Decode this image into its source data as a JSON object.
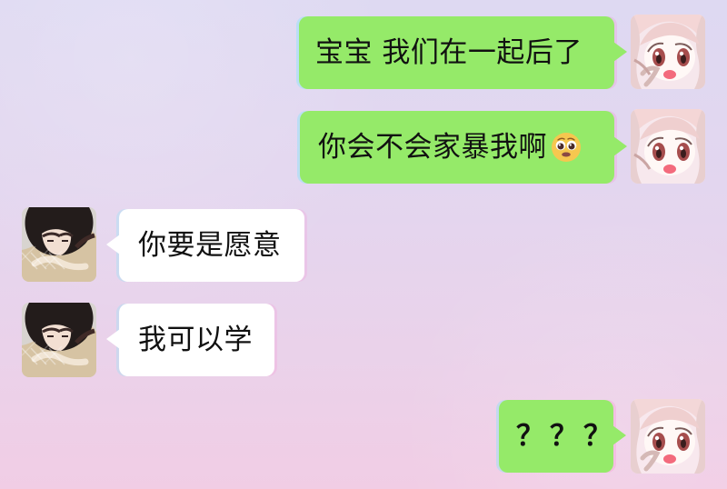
{
  "messages": [
    {
      "side": "right",
      "text": "宝宝 我们在一起后了",
      "avatar_icon": "anime-girl-avatar"
    },
    {
      "side": "right",
      "text": "你会不会家暴我啊",
      "emoji_icon": "pleading-face-icon",
      "avatar_icon": "anime-girl-avatar"
    },
    {
      "side": "left",
      "text": "你要是愿意",
      "avatar_icon": "anime-boy-avatar"
    },
    {
      "side": "left",
      "text": "我可以学",
      "avatar_icon": "anime-boy-avatar"
    },
    {
      "side": "right",
      "text": "？？？",
      "avatar_icon": "anime-girl-avatar"
    }
  ],
  "colors": {
    "background_top": "#ded9f2",
    "background_bottom": "#f1cde5",
    "outgoing_bubble": "#95ea69",
    "incoming_bubble": "#ffffff",
    "text": "#111111"
  }
}
